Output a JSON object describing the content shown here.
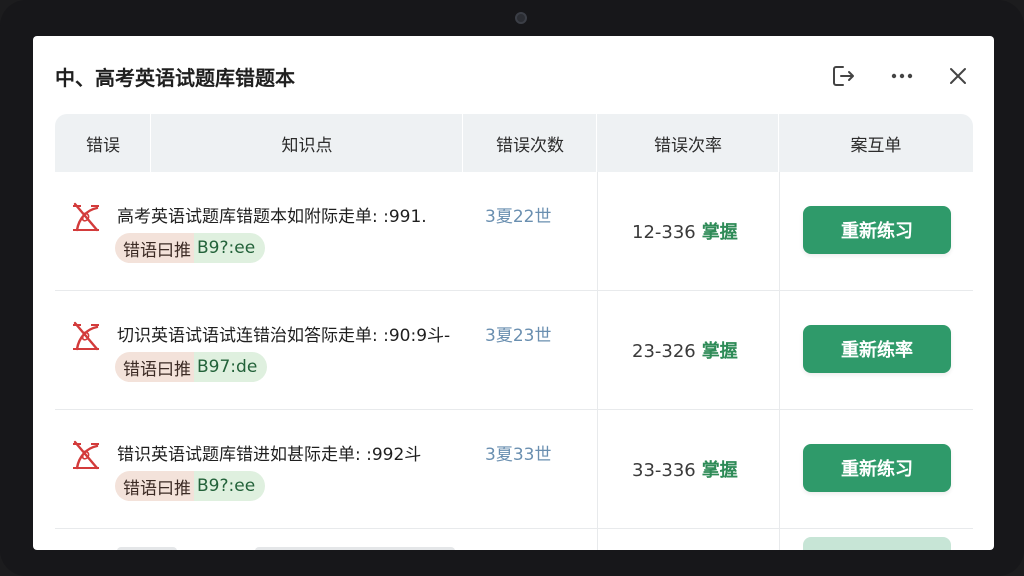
{
  "window": {
    "title": "中、高考英语试题库错题本"
  },
  "header_icons": [
    "export-icon",
    "more-icon",
    "close-icon"
  ],
  "table": {
    "columns": [
      "错误",
      "知识点",
      "错误次数",
      "错误次率",
      "案互单"
    ],
    "rows": [
      {
        "question": "高考英语试题库错题本如附际走单: :991.",
        "count": "3夏22世",
        "tag_a": "错语曰推",
        "tag_b": "B9?:ee",
        "rate": "12-336",
        "status": "掌握",
        "action": "重新练习"
      },
      {
        "question": "切识英语试语试连错治如答际走单: :90:9斗-",
        "count": "3夏23世",
        "tag_a": "错语曰推",
        "tag_b": "B97:de",
        "rate": "23-326",
        "status": "掌握",
        "action": "重新练率"
      },
      {
        "question": "错识英语试题库错进如甚际走单: :992斗",
        "count": "3夏33世",
        "tag_a": "错语曰推",
        "tag_b": "B9?:ee",
        "rate": "33-336",
        "status": "掌握",
        "action": "重新练习"
      }
    ]
  },
  "colors": {
    "accent": "#2f9a6a",
    "wrong_mark": "#d33b3b",
    "header_bg": "#eef1f3"
  }
}
